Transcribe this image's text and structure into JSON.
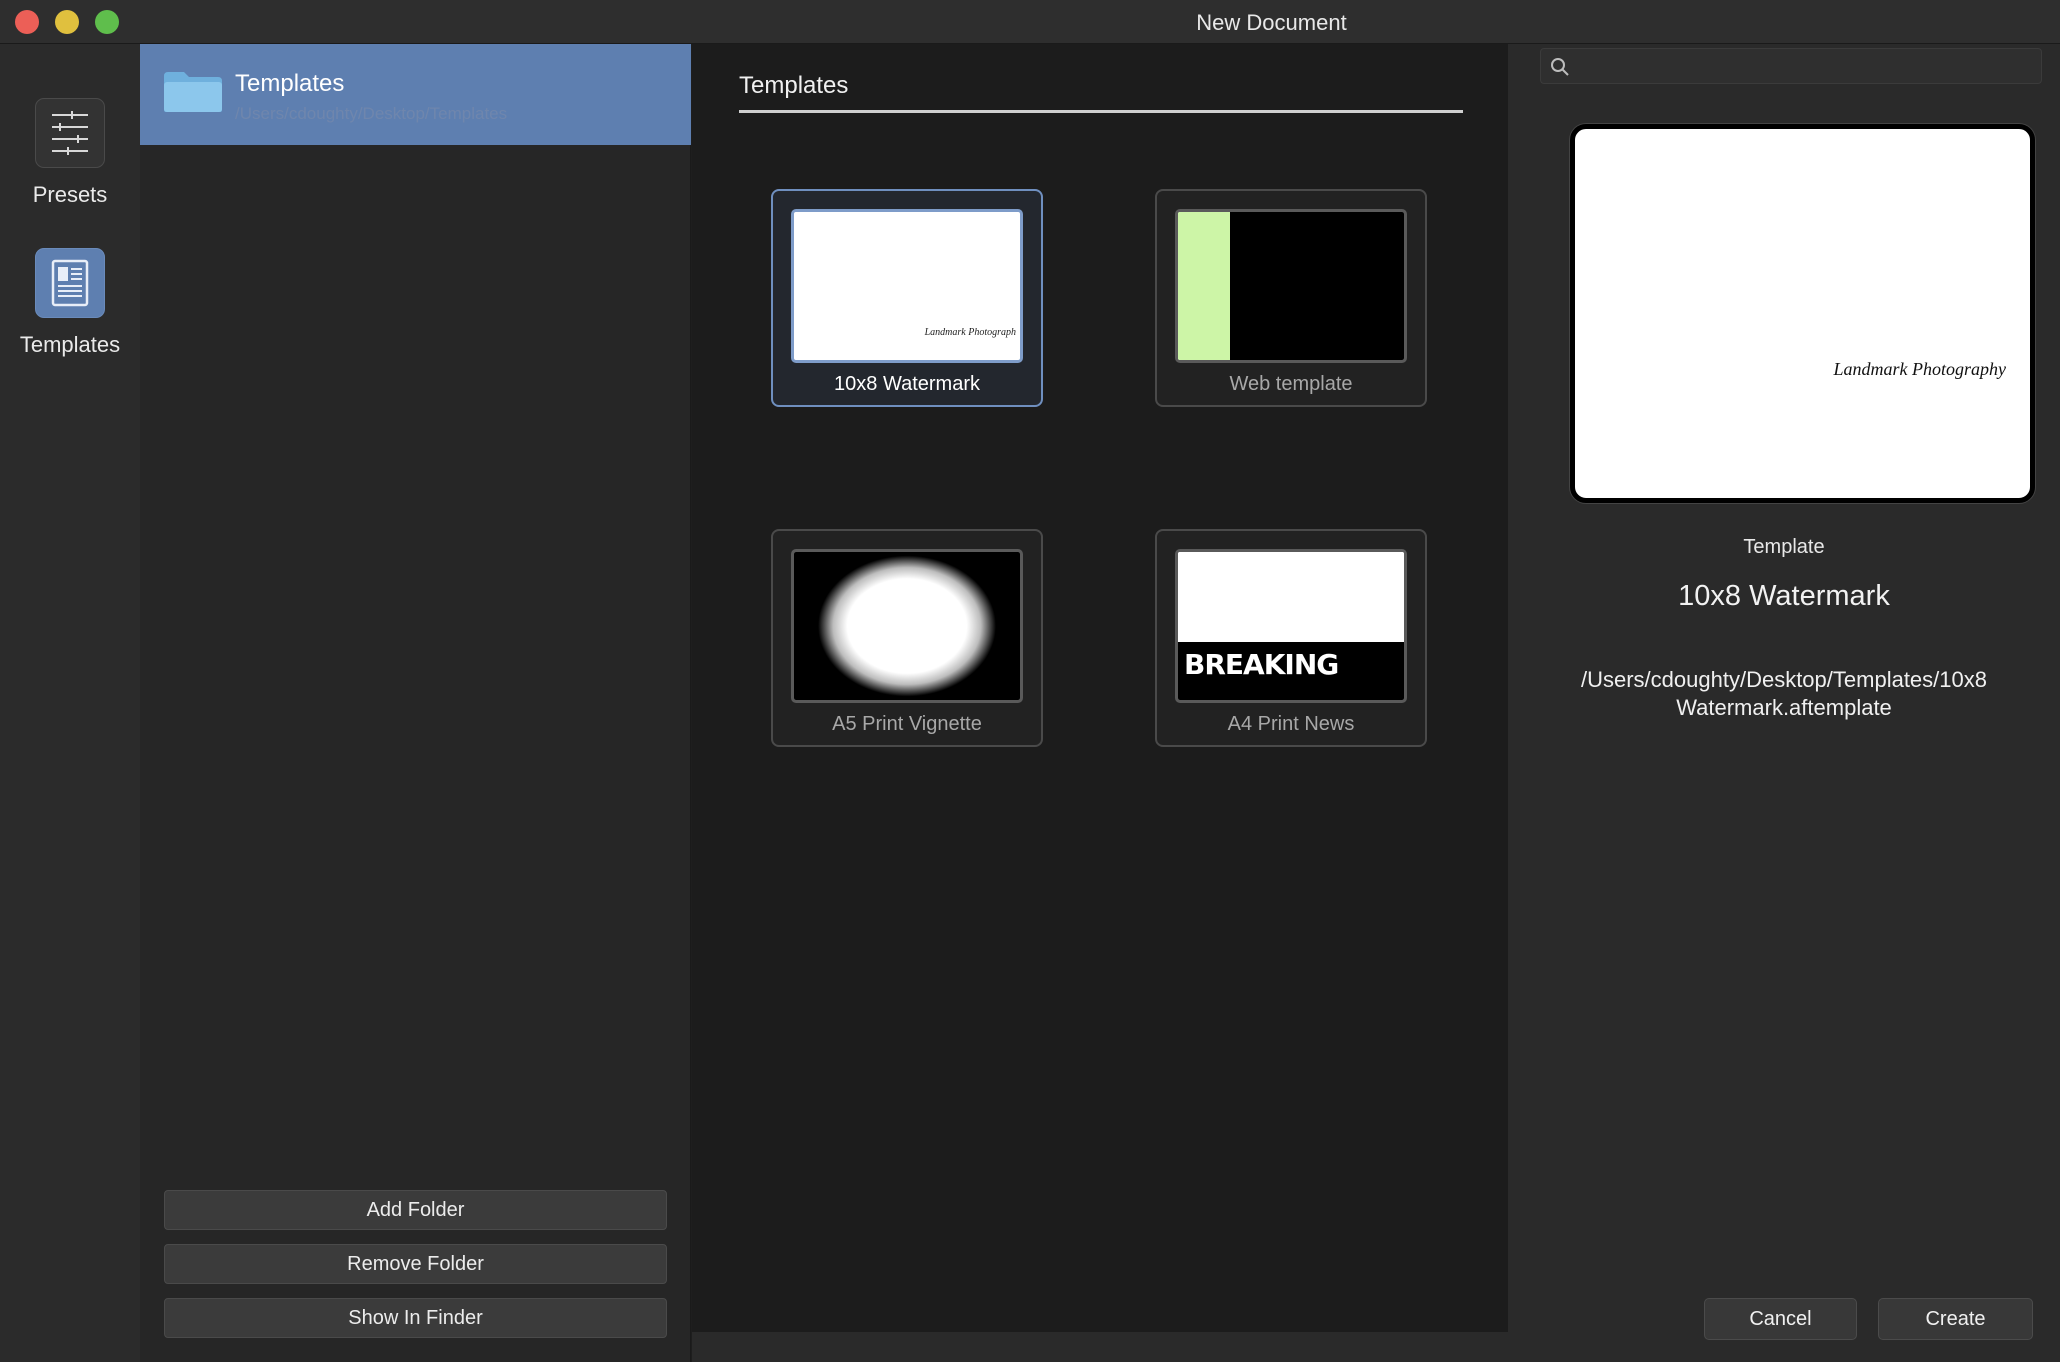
{
  "window": {
    "title": "New Document"
  },
  "rail": {
    "presets_label": "Presets",
    "templates_label": "Templates",
    "active": "templates"
  },
  "folders": {
    "items": [
      {
        "name": "Templates",
        "path": "/Users/cdoughty/Desktop/Templates"
      }
    ],
    "add_label": "Add Folder",
    "remove_label": "Remove Folder",
    "finder_label": "Show In Finder"
  },
  "grid": {
    "title": "Templates",
    "tiles": [
      {
        "label": "10x8 Watermark",
        "watermark_text": "Landmark Photograph",
        "selected": true
      },
      {
        "label": "Web template",
        "accent_color": "#cdf5a7"
      },
      {
        "label": "A5 Print Vignette"
      },
      {
        "label": "A4 Print News",
        "headline_text": "BREAKING"
      }
    ]
  },
  "detail": {
    "search_placeholder": "",
    "preview_watermark": "Landmark Photography",
    "kind": "Template",
    "name": "10x8 Watermark",
    "path": "/Users/cdoughty/Desktop/Templates/10x8 Watermark.aftemplate",
    "cancel_label": "Cancel",
    "create_label": "Create"
  },
  "colors": {
    "selection": "#5e7fb0",
    "close": "#ec5f57",
    "minimize": "#e0c03e",
    "maximize": "#5fbe4c"
  }
}
